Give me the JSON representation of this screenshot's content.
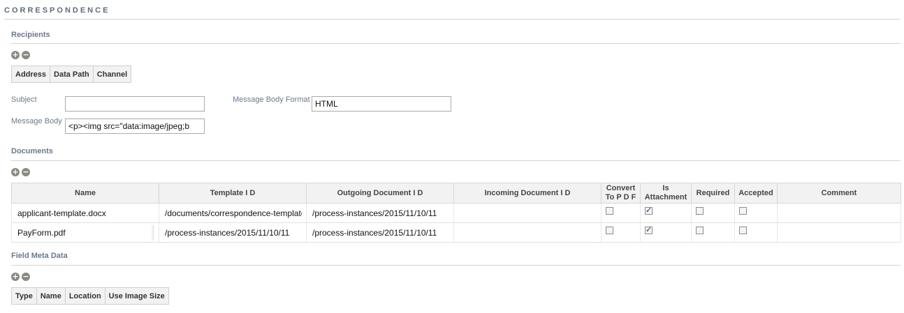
{
  "page_title": "CORRESPONDENCE",
  "recipients": {
    "title": "Recipients",
    "columns": [
      "Address",
      "Data Path",
      "Channel"
    ]
  },
  "form": {
    "subject_label": "Subject",
    "subject_value": "",
    "message_body_label": "Message Body",
    "message_body_value": "<p><img src=\"data:image/jpeg;b",
    "message_body_format_label": "Message Body Format",
    "message_body_format_value": "HTML"
  },
  "documents": {
    "title": "Documents",
    "headers": {
      "name": "Name",
      "template_id": "Template I D",
      "outgoing_id": "Outgoing Document I D",
      "incoming_id": "Incoming Document I D",
      "convert_line1": "Convert",
      "convert_line2": "To P D F",
      "attach_line1": "Is",
      "attach_line2": "Attachment",
      "required": "Required",
      "accepted": "Accepted",
      "comment": "Comment"
    },
    "rows": [
      {
        "name": "applicant-template.docx",
        "template_id": "/documents/correspondence-template",
        "outgoing_id": "/process-instances/2015/11/10/11",
        "incoming_id": "",
        "convert_to_pdf": false,
        "is_attachment": true,
        "required": false,
        "accepted": false,
        "comment": ""
      },
      {
        "name": "PayForm.pdf",
        "template_id": "/process-instances/2015/11/10/11",
        "outgoing_id": "/process-instances/2015/11/10/11",
        "incoming_id": "",
        "convert_to_pdf": false,
        "is_attachment": true,
        "required": false,
        "accepted": false,
        "comment": ""
      }
    ]
  },
  "field_meta": {
    "title": "Field Meta Data",
    "columns": [
      "Type",
      "Name",
      "Location",
      "Use Image Size"
    ]
  },
  "icons": {
    "add": "plus-circle-icon",
    "remove": "minus-circle-icon"
  }
}
